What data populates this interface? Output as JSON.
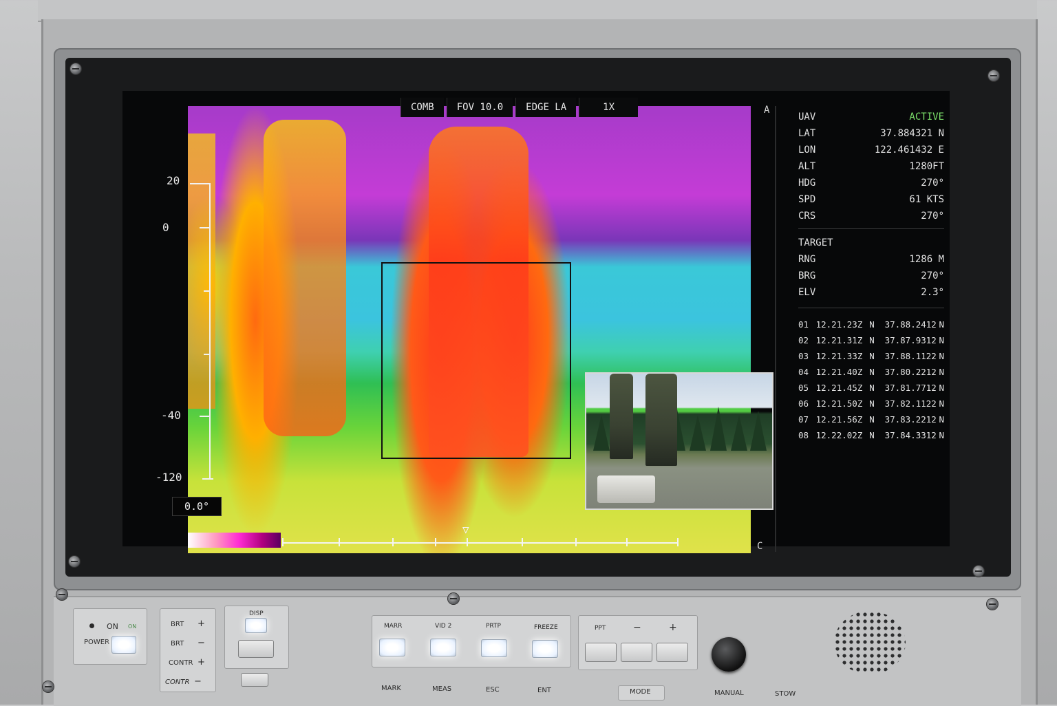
{
  "screen": {
    "tabs": [
      "COMB",
      "FOV 10.0",
      "EDGE LA",
      "1X"
    ],
    "corner_top": "A",
    "corner_bottom": "C",
    "scale_labels": [
      "20",
      "0",
      "-40",
      "-120"
    ],
    "angle_readout": "0.0°"
  },
  "uav": {
    "header_label": "UAV",
    "status": "ACTIVE",
    "status_color": "#7be06a",
    "fields": [
      {
        "label": "LAT",
        "value": "37.884321 N"
      },
      {
        "label": "LON",
        "value": "122.461432 E"
      },
      {
        "label": "ALT",
        "value": "1280FT"
      },
      {
        "label": "HDG",
        "value": "270°"
      },
      {
        "label": "SPD",
        "value": "61 KTS"
      },
      {
        "label": "CRS",
        "value": "270°"
      }
    ]
  },
  "target": {
    "header_label": "TARGET",
    "fields": [
      {
        "label": "RNG",
        "value": "1286  M"
      },
      {
        "label": "BRG",
        "value": "270°"
      },
      {
        "label": "ELV",
        "value": "2.3°"
      }
    ]
  },
  "log": [
    {
      "id": "01",
      "time": "12.21.23Z",
      "ns": "N",
      "lat": "37.88.2412",
      "dir": "N"
    },
    {
      "id": "02",
      "time": "12.21.31Z",
      "ns": "N",
      "lat": "37.87.9312",
      "dir": "N"
    },
    {
      "id": "03",
      "time": "12.21.33Z",
      "ns": "N",
      "lat": "37.88.1122",
      "dir": "N"
    },
    {
      "id": "04",
      "time": "12.21.40Z",
      "ns": "N",
      "lat": "37.80.2212",
      "dir": "N"
    },
    {
      "id": "05",
      "time": "12.21.45Z",
      "ns": "N",
      "lat": "37.81.7712",
      "dir": "N"
    },
    {
      "id": "06",
      "time": "12.21.50Z",
      "ns": "N",
      "lat": "37.82.1122",
      "dir": "N"
    },
    {
      "id": "07",
      "time": "12.21.56Z",
      "ns": "N",
      "lat": "37.83.2212",
      "dir": "N"
    },
    {
      "id": "08",
      "time": "12.22.02Z",
      "ns": "N",
      "lat": "37.84.3312",
      "dir": "N"
    }
  ],
  "panel": {
    "power": {
      "on_label": "ON",
      "on_sub": "ON",
      "power_label": "POWER"
    },
    "brightness": [
      "BRT",
      "BRT",
      "CONTR",
      "CONTR"
    ],
    "brightness_signs": [
      "+",
      "−",
      "+",
      "−"
    ],
    "disp_label": "DISP",
    "top_buttons": [
      "MARR",
      "VID 2",
      "PRTP",
      "FREEZE"
    ],
    "bottom_labels": [
      "MARK",
      "MEAS",
      "ESC",
      "ENT"
    ],
    "ppt": {
      "label": "PPT",
      "minus": "−",
      "plus": "+"
    },
    "mode_label": "MODE",
    "manual_label": "MANUAL",
    "stow_label": "STOW"
  }
}
